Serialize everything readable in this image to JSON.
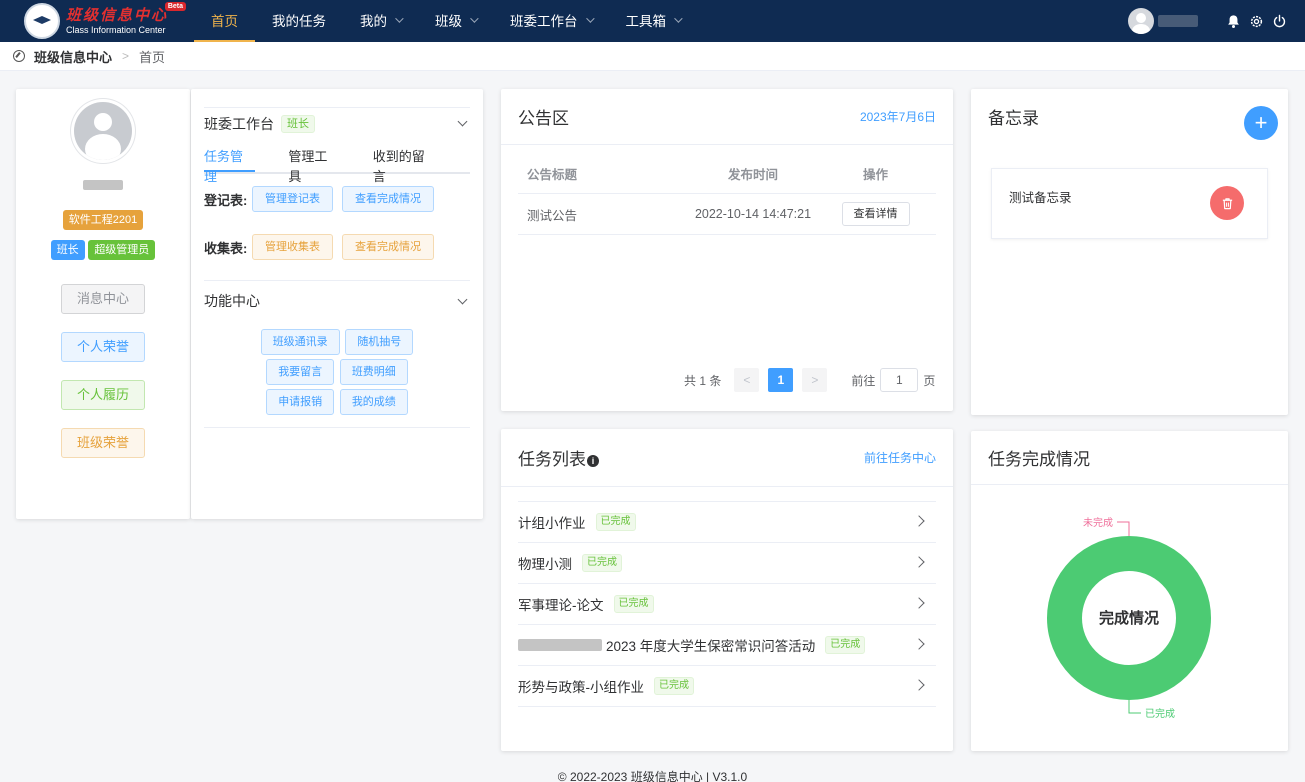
{
  "app": {
    "logo_cn": "班级信息中心",
    "logo_en": "Class Information Center",
    "beta": "Beta"
  },
  "nav": [
    {
      "label": "首页",
      "active": true,
      "has_menu": false
    },
    {
      "label": "我的任务",
      "active": false,
      "has_menu": false
    },
    {
      "label": "我的",
      "active": false,
      "has_menu": true
    },
    {
      "label": "班级",
      "active": false,
      "has_menu": true
    },
    {
      "label": "班委工作台",
      "active": false,
      "has_menu": true
    },
    {
      "label": "工具箱",
      "active": false,
      "has_menu": true
    }
  ],
  "breadcrumb": {
    "home": "班级信息中心",
    "current": "首页"
  },
  "profile": {
    "major_tag": "软件工程2201",
    "role_tags": [
      "班长",
      "超级管理员"
    ],
    "buttons": [
      "消息中心",
      "个人荣誉",
      "个人履历",
      "班级荣誉"
    ]
  },
  "workbench": {
    "title": "班委工作台",
    "role_tag": "班长",
    "tabs": [
      "任务管理",
      "管理工具",
      "收到的留言"
    ],
    "register_label": "登记表:",
    "register_buttons": [
      "管理登记表",
      "查看完成情况"
    ],
    "collect_label": "收集表:",
    "collect_buttons": [
      "管理收集表",
      "查看完成情况"
    ],
    "func_title": "功能中心",
    "func_rows": [
      [
        "班级通讯录",
        "随机抽号"
      ],
      [
        "我要留言",
        "班费明细"
      ],
      [
        "申请报销",
        "我的成绩"
      ]
    ]
  },
  "notice": {
    "title": "公告区",
    "date": "2023年7月6日",
    "columns": [
      "公告标题",
      "发布时间",
      "操作"
    ],
    "rows": [
      {
        "title": "测试公告",
        "time": "2022-10-14 14:47:21",
        "action": "查看详情"
      }
    ],
    "pager": {
      "total": "共 1 条",
      "current": "1",
      "goto_prefix": "前往",
      "goto_value": "1",
      "goto_suffix": "页"
    }
  },
  "memo": {
    "title": "备忘录",
    "items": [
      "测试备忘录"
    ]
  },
  "tasks": {
    "title": "任务列表",
    "link": "前往任务中心",
    "items": [
      {
        "name": "计组小作业",
        "status": "已完成",
        "blurred_prefix": false
      },
      {
        "name": "物理小测",
        "status": "已完成",
        "blurred_prefix": false
      },
      {
        "name": "军事理论-论文",
        "status": "已完成",
        "blurred_prefix": false
      },
      {
        "name": "2023 年度大学生保密常识问答活动",
        "status": "已完成",
        "blurred_prefix": true
      },
      {
        "name": "形势与政策-小组作业",
        "status": "已完成",
        "blurred_prefix": false
      }
    ]
  },
  "completion": {
    "title": "任务完成情况",
    "center_label": "完成情况"
  },
  "chart_data": {
    "type": "pie",
    "title": "完成情况",
    "categories": [
      "已完成",
      "未完成"
    ],
    "values": [
      5,
      0
    ],
    "colors": [
      "#4ccb73",
      "#ef6f9a"
    ]
  },
  "footer": "© 2022-2023 班级信息中心 | V3.1.0"
}
